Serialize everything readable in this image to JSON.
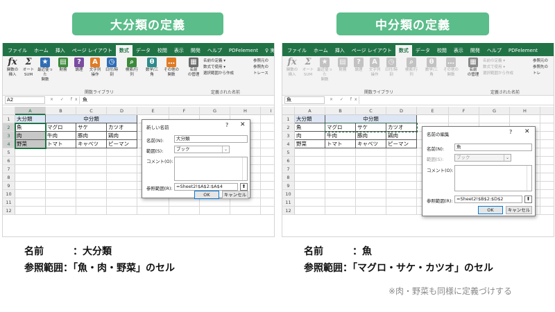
{
  "left": {
    "banner": "大分類の定義",
    "tabs": [
      "ファイル",
      "ホーム",
      "挿入",
      "ページ レイアウト",
      "数式",
      "データ",
      "校閲",
      "表示",
      "開発",
      "ヘルプ",
      "PDFelement"
    ],
    "tab_right": "実行",
    "ribbon": {
      "buttons": [
        {
          "label": "関数の\n挿入",
          "icon": "fx-icon",
          "glyph": "fx",
          "color": "#ffffff"
        },
        {
          "label": "オート\nSUM",
          "icon": "sigma-icon",
          "glyph": "Σ",
          "color": "#ffffff"
        },
        {
          "label": "最近使った\n関数",
          "icon": "star-icon",
          "glyph": "★",
          "color": "#2f6db5"
        },
        {
          "label": "財務",
          "icon": "book-icon",
          "glyph": "▤",
          "color": "#3c8a3c"
        },
        {
          "label": "論理",
          "icon": "question-book-icon",
          "glyph": "?",
          "color": "#7a4ca0"
        },
        {
          "label": "文字列\n操作",
          "icon": "text-book-icon",
          "glyph": "A",
          "color": "#e07b24"
        },
        {
          "label": "日付/時刻",
          "icon": "clock-book-icon",
          "glyph": "◷",
          "color": "#2f6db5"
        },
        {
          "label": "検索/行列",
          "icon": "search-book-icon",
          "glyph": "⌕",
          "color": "#3c8a3c"
        },
        {
          "label": "数学/三角",
          "icon": "theta-book-icon",
          "glyph": "θ",
          "color": "#2e8b8b"
        },
        {
          "label": "その他の\n関数",
          "icon": "more-functions-icon",
          "glyph": "…",
          "color": "#e07b24"
        },
        {
          "label": "名前\nの管理",
          "icon": "name-manager-icon",
          "glyph": "▦",
          "color": "#6b6b6b"
        }
      ],
      "side_items": [
        "名前の定義 ▾",
        "数式で使用 ▾",
        "選択範囲から作成"
      ],
      "far_items": [
        "参照元の",
        "参照先の",
        "トレース"
      ],
      "group_function_library": "関数ライブラリ",
      "group_defined_names": "定義された名前"
    },
    "formula_bar": {
      "namebox": "A2",
      "fx": "× ✓ fx",
      "content": "魚"
    },
    "columns": [
      "A",
      "B",
      "C",
      "D",
      "E",
      "F",
      "G",
      "H",
      "I"
    ],
    "rows": [
      "1",
      "2",
      "3",
      "4",
      "5",
      "6",
      "7",
      "8",
      "9",
      "10",
      "11",
      "12"
    ],
    "cells": {
      "A1": "大分類",
      "BD1": "中分類",
      "A2": "魚",
      "B2": "マグロ",
      "C2": "サケ",
      "D2": "カツオ",
      "A3": "肉",
      "B3": "牛肉",
      "C3": "豚肉",
      "D3": "鶏肉",
      "A4": "野菜",
      "B4": "トマト",
      "C4": "キャベツ",
      "D4": "ピーマン"
    },
    "dialog": {
      "title": "新しい名前",
      "name_label": "名前(N):",
      "name_value": "大分類",
      "scope_label": "範囲(S):",
      "scope_value": "ブック",
      "comment_label": "コメント(O):",
      "ref_label": "参照範囲(R):",
      "ref_value": "=Sheet2!$A$2:$A$4",
      "ok": "OK",
      "cancel": "キャンセル"
    }
  },
  "right": {
    "banner": "中分類の定義",
    "tabs": [
      "ファイル",
      "ホーム",
      "挿入",
      "ページ レイアウト",
      "数式",
      "データ",
      "校閲",
      "表示",
      "開発",
      "ヘルプ",
      "PDFelement"
    ],
    "ribbon": {
      "buttons": [
        {
          "label": "関数の\n挿入",
          "glyph": "fx",
          "icon": "fx-icon"
        },
        {
          "label": "オート\nSUM",
          "glyph": "Σ",
          "icon": "sigma-icon"
        },
        {
          "label": "最近使った\n関数",
          "glyph": "★",
          "icon": "star-icon"
        },
        {
          "label": "財務",
          "glyph": "▤",
          "icon": "book-icon"
        },
        {
          "label": "論理",
          "glyph": "?",
          "icon": "question-book-icon"
        },
        {
          "label": "文字列\n操作",
          "glyph": "A",
          "icon": "text-book-icon"
        },
        {
          "label": "日付/時刻",
          "glyph": "◷",
          "icon": "clock-book-icon"
        },
        {
          "label": "検索/行列",
          "glyph": "⌕",
          "icon": "search-book-icon"
        },
        {
          "label": "数学/三角",
          "glyph": "θ",
          "icon": "theta-book-icon"
        },
        {
          "label": "その他の\n関数",
          "glyph": "…",
          "icon": "more-functions-icon"
        },
        {
          "label": "名前\nの管理",
          "glyph": "▦",
          "icon": "name-manager-icon"
        }
      ],
      "side_items": [
        "名前の定義 ▾",
        "数式で使用 ▾",
        "選択範囲から作成"
      ],
      "far_items": [
        "参照元の",
        "参照先の",
        "トレ"
      ],
      "group_function_library": "関数ライブラリ",
      "group_defined_names": "定義された名前"
    },
    "formula_bar": {
      "namebox": "魚",
      "fx": "× ✓ fx",
      "content": ""
    },
    "columns": [
      "A",
      "B",
      "C",
      "D",
      "E",
      "F",
      "G",
      "H"
    ],
    "rows": [
      "1",
      "2",
      "3",
      "4",
      "5",
      "6",
      "7",
      "8",
      "9",
      "10",
      "11",
      "12"
    ],
    "cells": {
      "A1": "大分類",
      "BD1": "中分類",
      "A2": "魚",
      "B2": "マグロ",
      "C2": "サケ",
      "D2": "カツオ",
      "A3": "肉",
      "B3": "牛肉",
      "C3": "豚肉",
      "D3": "鶏肉",
      "A4": "野菜",
      "B4": "トマト",
      "C4": "キャベツ",
      "D4": "ピーマン"
    },
    "dialog": {
      "title": "名前の編集",
      "name_label": "名前(N):",
      "name_value": "魚",
      "scope_label": "範囲(S):",
      "scope_value": "ブック",
      "comment_label": "コメント(O):",
      "ref_label": "参照範囲(R):",
      "ref_value": "=Sheet2!$B$2:$D$2",
      "ok": "OK",
      "cancel": "キャンセル"
    }
  },
  "notes": {
    "left_name": "名前　　　：大分類",
    "left_ref": "参照範囲：「魚・肉・野菜」のセル",
    "right_name": "名前　　　：魚",
    "right_ref": "参照範囲：「マグロ・サケ・カツオ」のセル",
    "footnote": "※肉・野菜も同様に定義づけする"
  },
  "colors": {
    "excel_green": "#217346",
    "banner_green": "#5bbd8a",
    "header_blue": "#dde6f4"
  }
}
